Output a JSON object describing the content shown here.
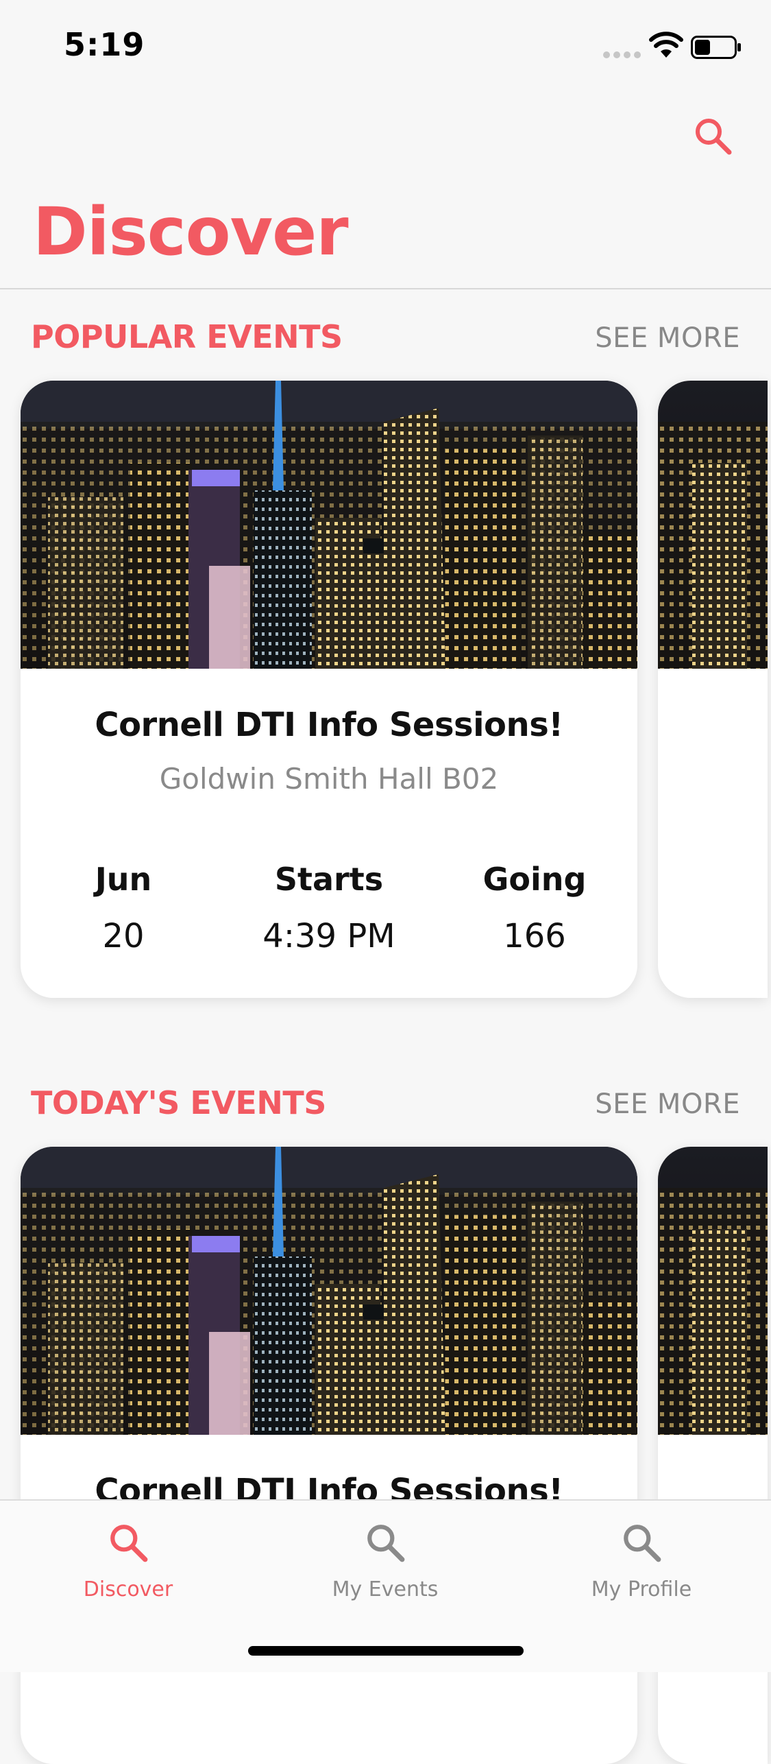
{
  "status_bar": {
    "time": "5:19"
  },
  "header": {
    "title": "Discover"
  },
  "sections": [
    {
      "title": "POPULAR EVENTS",
      "see_more": "SEE MORE",
      "event": {
        "name": "Cornell DTI Info Sessions!",
        "location": "Goldwin Smith Hall B02",
        "stats": [
          {
            "label": "Jun",
            "value": "20"
          },
          {
            "label": "Starts",
            "value": "4:39 PM"
          },
          {
            "label": "Going",
            "value": "166"
          }
        ]
      }
    },
    {
      "title": "TODAY'S EVENTS",
      "see_more": "SEE MORE",
      "event": {
        "name": "Cornell DTI Info Sessions!"
      }
    }
  ],
  "tabs": [
    {
      "label": "Discover",
      "icon": "search-icon",
      "active": true
    },
    {
      "label": "My Events",
      "icon": "search-icon",
      "active": false
    },
    {
      "label": "My Profile",
      "icon": "search-icon",
      "active": false
    }
  ],
  "colors": {
    "accent": "#f25a62",
    "muted": "#8a8a8a",
    "background": "#f7f7f7"
  }
}
